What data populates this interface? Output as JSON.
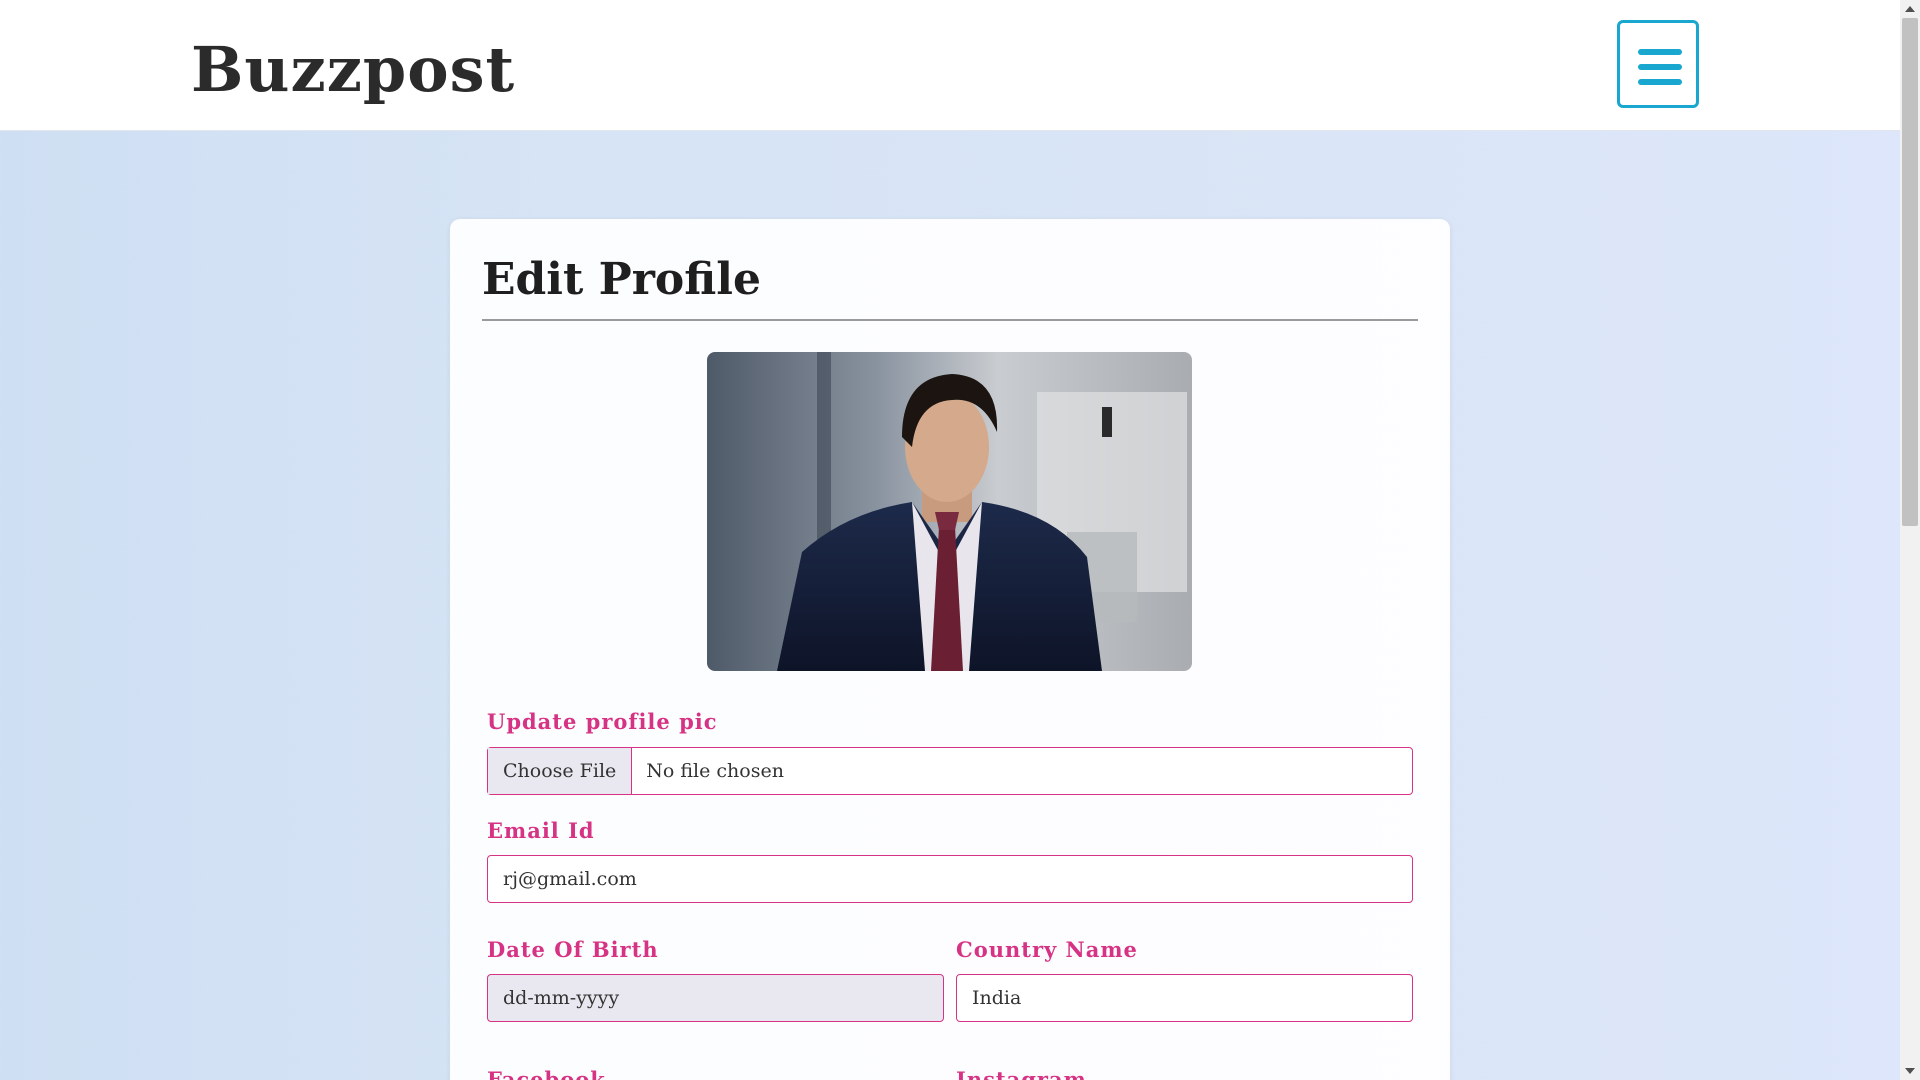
{
  "brand": "Buzzpost",
  "nav": {
    "menu_icon": "hamburger-menu-icon"
  },
  "profile": {
    "title": "Edit Profile",
    "photo_icon": "profile-photo"
  },
  "form": {
    "profile_pic_label": "Update profile pic",
    "choose_file_label": "Choose File",
    "file_status": "No file chosen",
    "email_label": "Email Id",
    "email_value": "rj@gmail.com",
    "dob_label": "Date Of Birth",
    "dob_placeholder": "dd-mm-yyyy",
    "country_label": "Country Name",
    "country_value": "India",
    "facebook_label": "Facebook",
    "instagram_label": "Instagram"
  },
  "colors": {
    "accent": "#d63384",
    "menu": "#1aa7cf"
  }
}
